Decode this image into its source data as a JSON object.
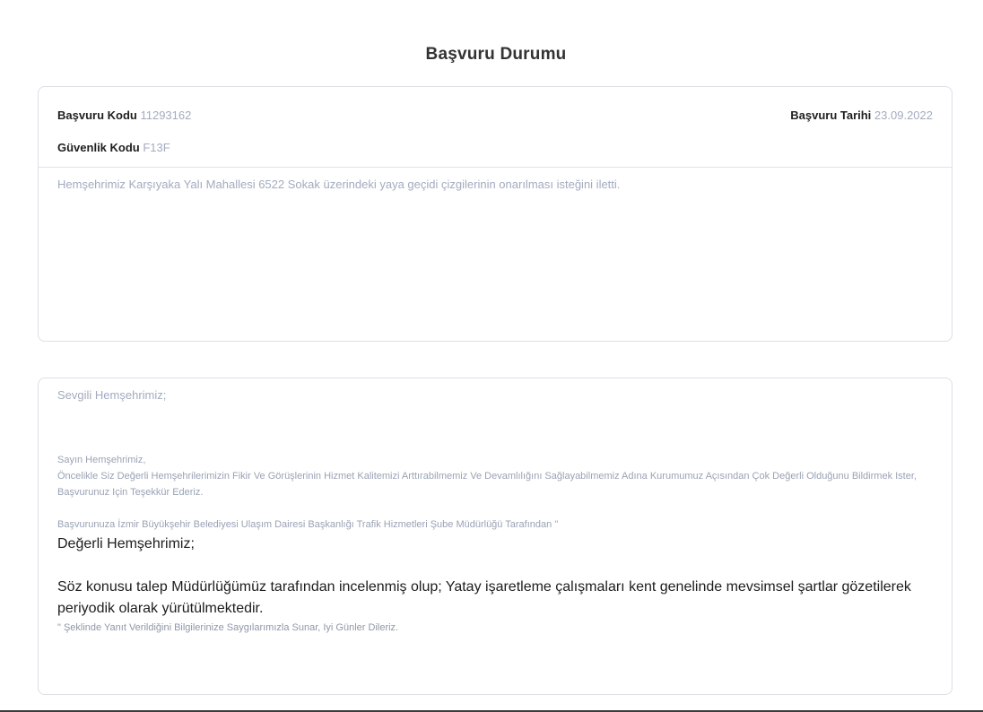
{
  "page": {
    "title": "Başvuru Durumu"
  },
  "application": {
    "code_label": "Başvuru Kodu",
    "code_value": "11293162",
    "date_label": "Başvuru Tarihi",
    "date_value": "23.09.2022",
    "security_label": "Güvenlik Kodu",
    "security_value": "F13F",
    "request_text": "Hemşehrimiz Karşıyaka Yalı Mahallesi 6522 Sokak üzerindeki yaya geçidi çizgilerinin onarılması isteğini iletti."
  },
  "response": {
    "greeting": "Sevgili Hemşehrimiz;",
    "sayin": "Sayın Hemşehrimiz,",
    "intro": "Öncelikle Siz Değerli Hemşehrilerimizin Fikir Ve Görüşlerinin Hizmet Kalitemizi Arttırabilmemiz Ve Devamlılığını Sağlayabilmemiz Adına Kurumumuz Açısından Çok Değerli Olduğunu Bildirmek Ister, Başvurunuz Için Teşekkür Ederiz.",
    "department_line": "Başvurunuza İzmir Büyükşehir Belediyesi Ulaşım Dairesi Başkanlığı Trafik Hizmetleri Şube Müdürlüğü Tarafından \"",
    "dear": "Değerli Hemşehrimiz;",
    "body": "Söz konusu talep Müdürlüğümüz tarafından incelenmiş olup; Yatay işaretleme çalışmaları kent genelinde mevsimsel şartlar gözetilerek periyodik olarak yürütülmektedir.",
    "closing": "\" Şeklinde Yanıt Verildiğini Bilgilerinize Saygılarımızla Sunar, Iyi Günler Dileriz."
  }
}
